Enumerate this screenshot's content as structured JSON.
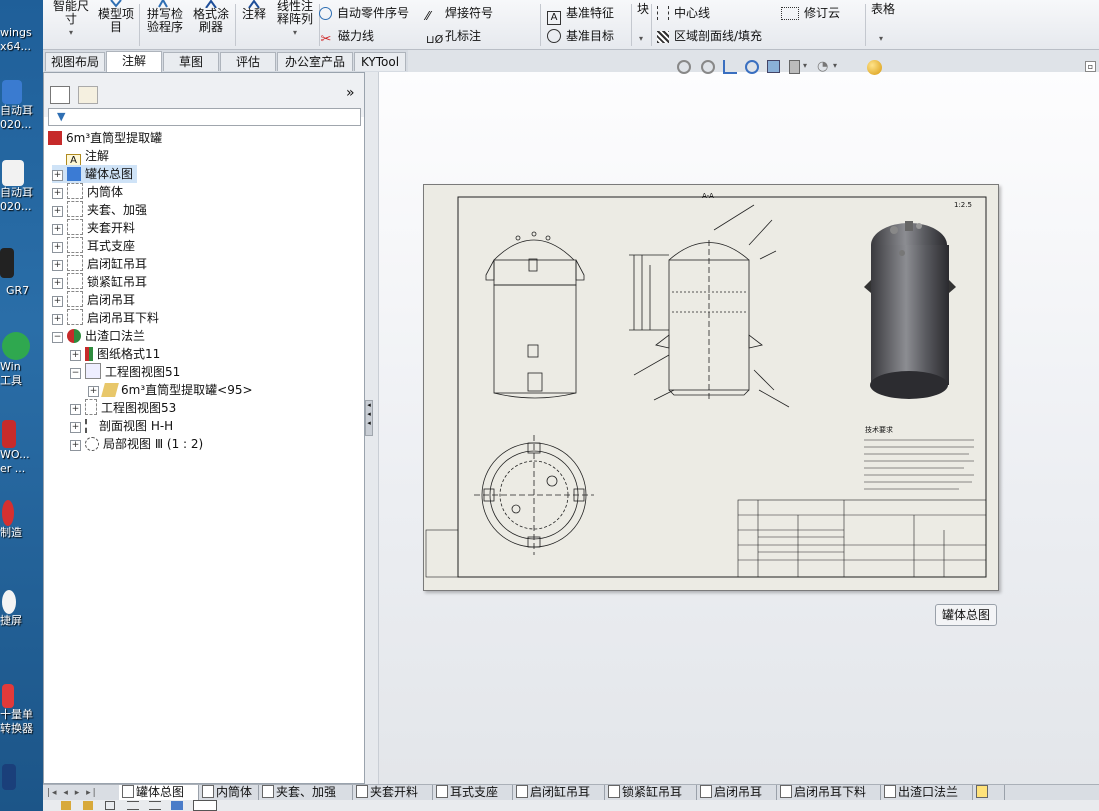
{
  "desktop": {
    "icons": [
      {
        "label": "wings\nx64..."
      },
      {
        "label": "自动耳\n020..."
      },
      {
        "label": "自动耳\n020..."
      },
      {
        "label": "GR7"
      },
      {
        "label": "Win\n工具"
      },
      {
        "label": "WO...\ner ..."
      },
      {
        "label": "制造"
      },
      {
        "label": "捷屏"
      },
      {
        "label": "十量单\n转换器"
      }
    ]
  },
  "ribbon": {
    "large": [
      {
        "label": "智能尺\n寸"
      },
      {
        "label": "模型项\n目"
      },
      {
        "label": "拼写检\n验程序"
      },
      {
        "label": "格式涂\n刷器"
      },
      {
        "label": "注释"
      },
      {
        "label": "线性注\n释阵列"
      }
    ],
    "small": [
      {
        "label": "自动零件序号"
      },
      {
        "label": "磁力线"
      },
      {
        "label": "焊接符号"
      },
      {
        "label": "孔标注"
      },
      {
        "label": "基准特征"
      },
      {
        "label": "基准目标"
      },
      {
        "label": "块"
      },
      {
        "label": "中心线"
      },
      {
        "label": "区域剖面线/填充"
      },
      {
        "label": "修订云"
      },
      {
        "label": "表格"
      }
    ]
  },
  "tabs": [
    {
      "label": "视图布局"
    },
    {
      "label": "注解"
    },
    {
      "label": "草图"
    },
    {
      "label": "评估"
    },
    {
      "label": "办公室产品"
    },
    {
      "label": "KYTool"
    }
  ],
  "panel": {
    "collapse_glyph": "»",
    "tree": [
      {
        "label": "6m³直筒型提取罐"
      },
      {
        "label": "注解"
      },
      {
        "label": "罐体总图"
      },
      {
        "label": "内筒体"
      },
      {
        "label": "夹套、加强"
      },
      {
        "label": "夹套开料"
      },
      {
        "label": "耳式支座"
      },
      {
        "label": "启闭缸吊耳"
      },
      {
        "label": "锁紧缸吊耳"
      },
      {
        "label": "启闭吊耳"
      },
      {
        "label": "启闭吊耳下料"
      },
      {
        "label": "出渣口法兰"
      },
      {
        "label": "图纸格式11"
      },
      {
        "label": "工程图视图51"
      },
      {
        "label": "6m³直筒型提取罐<95>"
      },
      {
        "label": "工程图视图53"
      },
      {
        "label": "剖面视图 H-H"
      },
      {
        "label": "局部视图 Ⅲ (1 : 2)"
      }
    ]
  },
  "canvas": {
    "sheet_label": "罐体总图",
    "drawing": {
      "section_label": "A-A",
      "scale_note": "1:2.5",
      "note_title": "技术要求"
    }
  },
  "bottom_tabs": [
    {
      "label": "罐体总图"
    },
    {
      "label": "内筒体"
    },
    {
      "label": "夹套、加强"
    },
    {
      "label": "夹套开料"
    },
    {
      "label": "耳式支座"
    },
    {
      "label": "启闭缸吊耳"
    },
    {
      "label": "锁紧缸吊耳"
    },
    {
      "label": "启闭吊耳"
    },
    {
      "label": "启闭吊耳下料"
    },
    {
      "label": "出渣口法兰"
    }
  ],
  "colors": {
    "selection": "#cfe3f7",
    "accent": "#2f6fb3"
  }
}
